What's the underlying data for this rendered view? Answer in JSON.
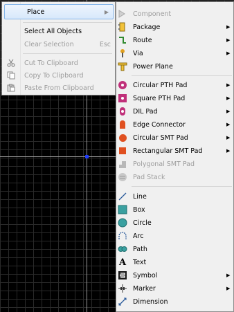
{
  "context_menu": {
    "place_label": "Place",
    "select_all_label": "Select All Objects",
    "clear_selection_label": "Clear Selection",
    "clear_selection_shortcut": "Esc",
    "cut_label": "Cut To Clipboard",
    "copy_label": "Copy To Clipboard",
    "paste_label": "Paste From Clipboard"
  },
  "place_submenu": {
    "component": "Component",
    "package": "Package",
    "route": "Route",
    "via": "Via",
    "power_plane": "Power Plane",
    "circular_pth_pad": "Circular PTH Pad",
    "square_pth_pad": "Square PTH Pad",
    "dil_pad": "DIL Pad",
    "edge_connector": "Edge Connector",
    "circular_smt_pad": "Circular SMT Pad",
    "rectangular_smt_pad": "Rectangular SMT Pad",
    "polygonal_smt_pad": "Polygonal SMT Pad",
    "pad_stack": "Pad Stack",
    "line": "Line",
    "box": "Box",
    "circle": "Circle",
    "arc": "Arc",
    "path": "Path",
    "text": "Text",
    "symbol": "Symbol",
    "marker": "Marker",
    "dimension": "Dimension"
  },
  "colors": {
    "pad_orange": "#e05020",
    "pad_magenta": "#c0307a",
    "shape_teal": "#3aa0a0",
    "highlight_border": "#87b7ea"
  }
}
